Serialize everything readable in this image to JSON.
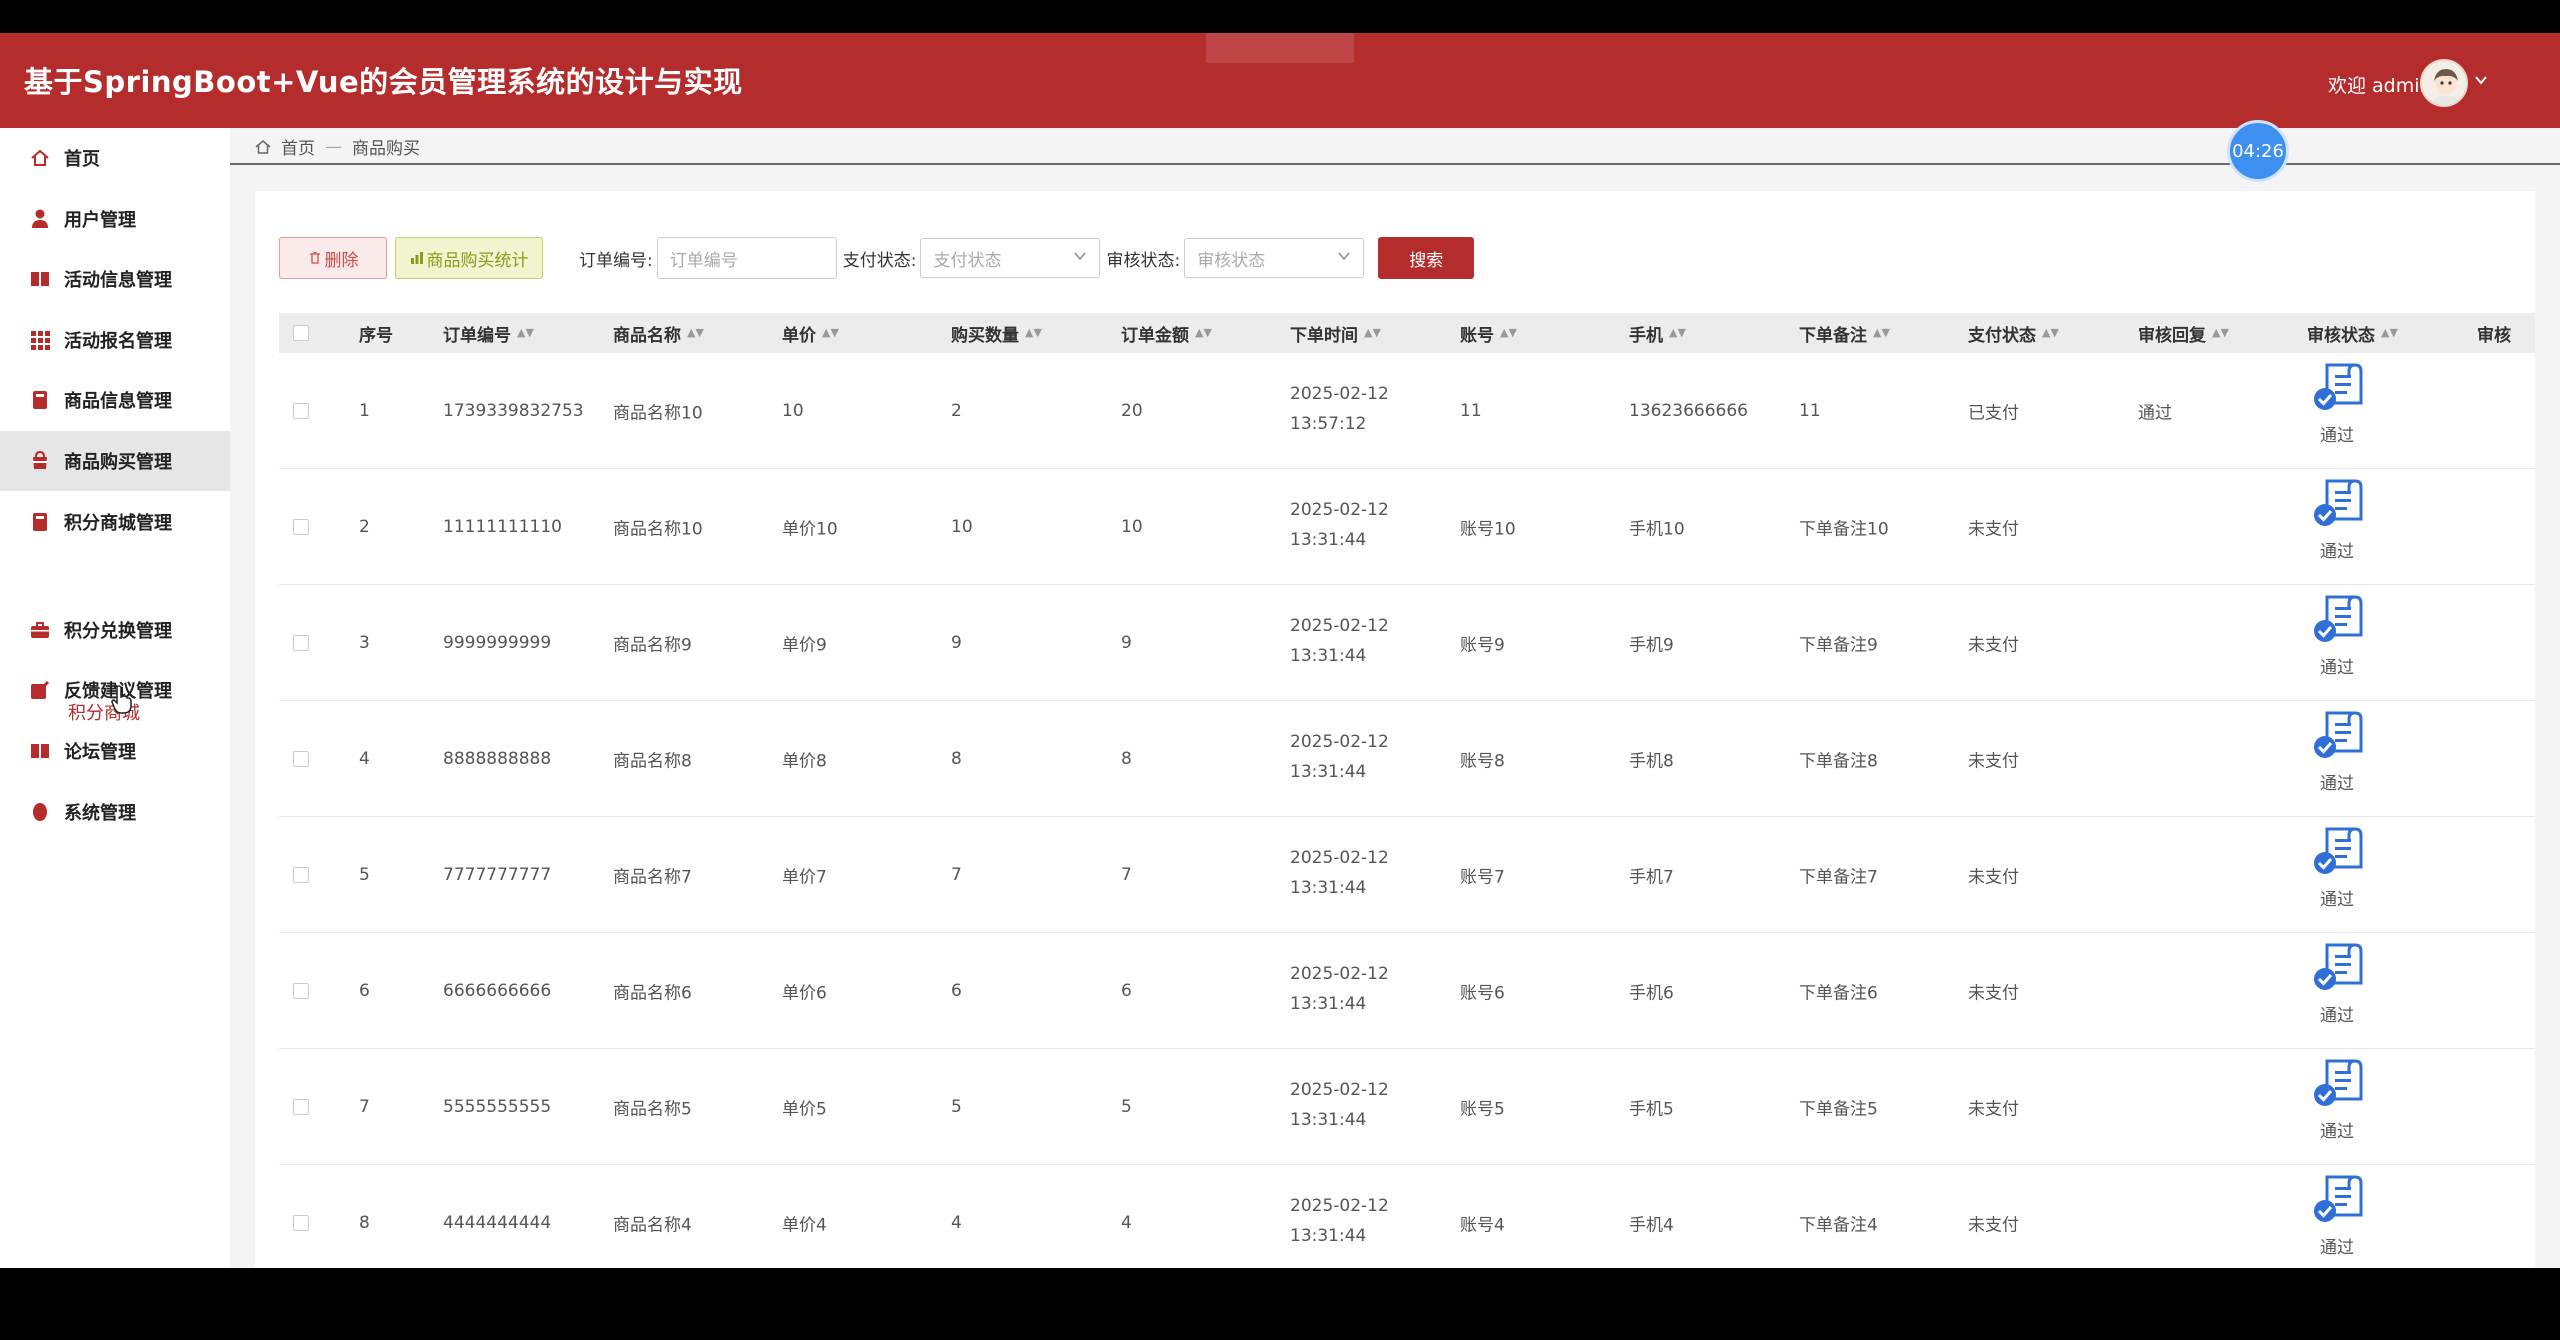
{
  "app": {
    "title": "基于SpringBoot+Vue的会员管理系统的设计与实现",
    "welcome": "欢迎 admin",
    "timer": "04:26"
  },
  "sidebar": {
    "items": [
      {
        "label": "首页",
        "icon": "home-icon"
      },
      {
        "label": "用户管理",
        "icon": "user-icon"
      },
      {
        "label": "活动信息管理",
        "icon": "book-icon"
      },
      {
        "label": "活动报名管理",
        "icon": "grid-icon"
      },
      {
        "label": "商品信息管理",
        "icon": "bookmark-icon"
      },
      {
        "label": "商品购买管理",
        "icon": "cart-icon"
      },
      {
        "label": "积分商城管理",
        "icon": "bookmark-icon"
      },
      {
        "label": "积分兑换管理",
        "icon": "briefcase-icon"
      },
      {
        "label": "反馈建议管理",
        "icon": "edit-icon"
      },
      {
        "label": "论坛管理",
        "icon": "book-icon"
      },
      {
        "label": "系统管理",
        "icon": "drop-icon"
      }
    ],
    "sub_item": "积分商城"
  },
  "breadcrumb": {
    "home": "首页",
    "sep": "—",
    "current": "商品购买"
  },
  "toolbar": {
    "delete_label": "删除",
    "stats_label": "商品购买统计",
    "order_no_label": "订单编号:",
    "order_no_placeholder": "订单编号",
    "pay_status_label": "支付状态:",
    "pay_status_placeholder": "支付状态",
    "audit_status_label": "审核状态:",
    "audit_status_placeholder": "审核状态",
    "search_label": "搜索"
  },
  "table": {
    "headers": [
      "序号",
      "订单编号",
      "商品名称",
      "单价",
      "购买数量",
      "订单金额",
      "下单时间",
      "账号",
      "手机",
      "下单备注",
      "支付状态",
      "审核回复",
      "审核状态",
      "审核"
    ],
    "rows": [
      {
        "idx": "1",
        "order_no": "1739339832753",
        "name": "商品名称10",
        "price": "10",
        "qty": "2",
        "amount": "20",
        "time": "2025-02-12 13:57:12",
        "account": "11",
        "phone": "13623666666",
        "remark": "11",
        "pay": "已支付",
        "reply": "通过",
        "audit": "通过"
      },
      {
        "idx": "2",
        "order_no": "11111111110",
        "name": "商品名称10",
        "price": "单价10",
        "qty": "10",
        "amount": "10",
        "time": "2025-02-12 13:31:44",
        "account": "账号10",
        "phone": "手机10",
        "remark": "下单备注10",
        "pay": "未支付",
        "reply": "",
        "audit": "通过"
      },
      {
        "idx": "3",
        "order_no": "9999999999",
        "name": "商品名称9",
        "price": "单价9",
        "qty": "9",
        "amount": "9",
        "time": "2025-02-12 13:31:44",
        "account": "账号9",
        "phone": "手机9",
        "remark": "下单备注9",
        "pay": "未支付",
        "reply": "",
        "audit": "通过"
      },
      {
        "idx": "4",
        "order_no": "8888888888",
        "name": "商品名称8",
        "price": "单价8",
        "qty": "8",
        "amount": "8",
        "time": "2025-02-12 13:31:44",
        "account": "账号8",
        "phone": "手机8",
        "remark": "下单备注8",
        "pay": "未支付",
        "reply": "",
        "audit": "通过"
      },
      {
        "idx": "5",
        "order_no": "7777777777",
        "name": "商品名称7",
        "price": "单价7",
        "qty": "7",
        "amount": "7",
        "time": "2025-02-12 13:31:44",
        "account": "账号7",
        "phone": "手机7",
        "remark": "下单备注7",
        "pay": "未支付",
        "reply": "",
        "audit": "通过"
      },
      {
        "idx": "6",
        "order_no": "6666666666",
        "name": "商品名称6",
        "price": "单价6",
        "qty": "6",
        "amount": "6",
        "time": "2025-02-12 13:31:44",
        "account": "账号6",
        "phone": "手机6",
        "remark": "下单备注6",
        "pay": "未支付",
        "reply": "",
        "audit": "通过"
      },
      {
        "idx": "7",
        "order_no": "5555555555",
        "name": "商品名称5",
        "price": "单价5",
        "qty": "5",
        "amount": "5",
        "time": "2025-02-12 13:31:44",
        "account": "账号5",
        "phone": "手机5",
        "remark": "下单备注5",
        "pay": "未支付",
        "reply": "",
        "audit": "通过"
      },
      {
        "idx": "8",
        "order_no": "4444444444",
        "name": "商品名称4",
        "price": "单价4",
        "qty": "4",
        "amount": "4",
        "time": "2025-02-12 13:31:44",
        "account": "账号4",
        "phone": "手机4",
        "remark": "下单备注4",
        "pay": "未支付",
        "reply": "",
        "audit": "通过"
      }
    ]
  },
  "colors": {
    "brand": "#b42c2c",
    "timer": "#3d8ff0",
    "audit_icon": "#2f6fd6"
  }
}
